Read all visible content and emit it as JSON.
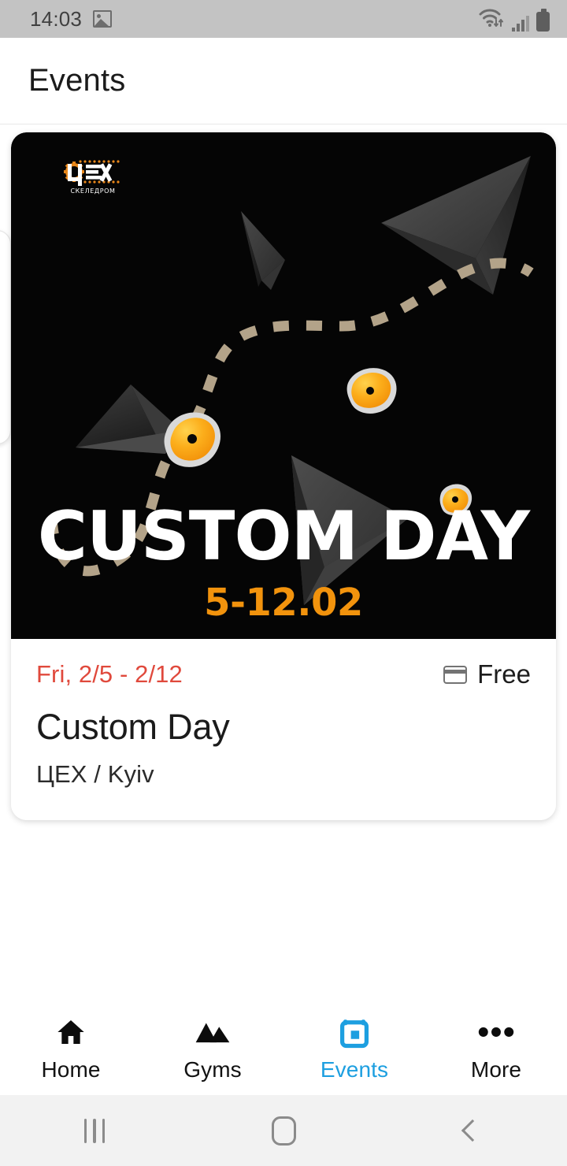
{
  "statusbar": {
    "time": "14:03",
    "icons": [
      "image-icon",
      "wifi-icon",
      "cellular-signal-icon",
      "battery-icon"
    ]
  },
  "appbar": {
    "title": "Events"
  },
  "event_card": {
    "poster": {
      "logo_main": "ЦЕХ",
      "logo_sub": "СКЕЛЕДРОМ",
      "title": "CUSTOM DAY",
      "date_range": "5-12.02",
      "background_color": "#050505",
      "accent_color": "#f2930d",
      "title_color": "#ffffff",
      "path_color": "#b3a389",
      "hold_color": "#fbb03b",
      "volume_color": "#3a3a3a"
    },
    "date": "Fri, 2/5 - 2/12",
    "date_color": "#e0493c",
    "price": "Free",
    "price_icon": "credit-card-icon",
    "title": "Custom Day",
    "location": "ЦЕХ / Kyiv"
  },
  "bottom_nav": {
    "active_color": "#1d9fe0",
    "items": [
      {
        "label": "Home",
        "icon": "home-icon",
        "active": false
      },
      {
        "label": "Gyms",
        "icon": "mountains-icon",
        "active": false
      },
      {
        "label": "Events",
        "icon": "calendar-icon",
        "active": true
      },
      {
        "label": "More",
        "icon": "more-dots-icon",
        "active": false
      }
    ]
  },
  "system_nav": {
    "recents_label": "recents-icon",
    "home_label": "home-button-icon",
    "back_label": "back-icon"
  }
}
